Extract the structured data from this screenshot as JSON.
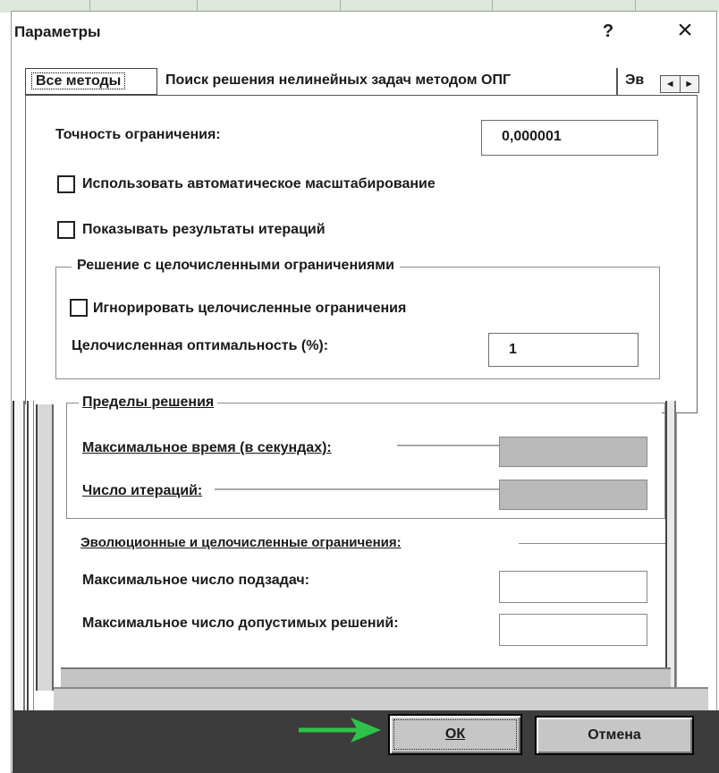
{
  "dialog": {
    "title": "Параметры",
    "help_label": "?",
    "close_label": "×"
  },
  "tabs": [
    {
      "label": "Все методы"
    },
    {
      "label": "Поиск решения нелинейных задач методом ОПГ"
    },
    {
      "label": "Эв"
    }
  ],
  "tab_scroll": {
    "left": "◄",
    "right": "►"
  },
  "options": {
    "constraint_precision": {
      "label": "Точность ограничения:",
      "value": "0,000001"
    },
    "auto_scaling": {
      "label": "Использовать автоматическое масштабирование",
      "checked": false
    },
    "show_iterations": {
      "label": "Показывать результаты итераций",
      "checked": false
    }
  },
  "integer_group": {
    "title": "Решение с целочисленными ограничениями",
    "ignore_integer": {
      "label": "Игнорировать целочисленные ограничения",
      "checked": false
    },
    "integer_optimality": {
      "label": "Целочисленная оптимальность (%):",
      "value": "1"
    }
  },
  "limits_group": {
    "title": "Пределы решения",
    "max_time": {
      "label": "Максимальное время (в секундах):",
      "value": ""
    },
    "iterations": {
      "label": "Число итераций:",
      "value": ""
    }
  },
  "evolutionary_group": {
    "title": "Эволюционные и целочисленные ограничения:",
    "max_subproblems": {
      "label": "Максимальное число подзадач:",
      "value": ""
    },
    "max_feasible": {
      "label": "Максимальное число допустимых решений:",
      "value": ""
    }
  },
  "buttons": {
    "ok": "ОК",
    "cancel": "Отмена"
  },
  "colors": {
    "arrow": "#2fc24a",
    "button_face": "#c6c6c6"
  }
}
